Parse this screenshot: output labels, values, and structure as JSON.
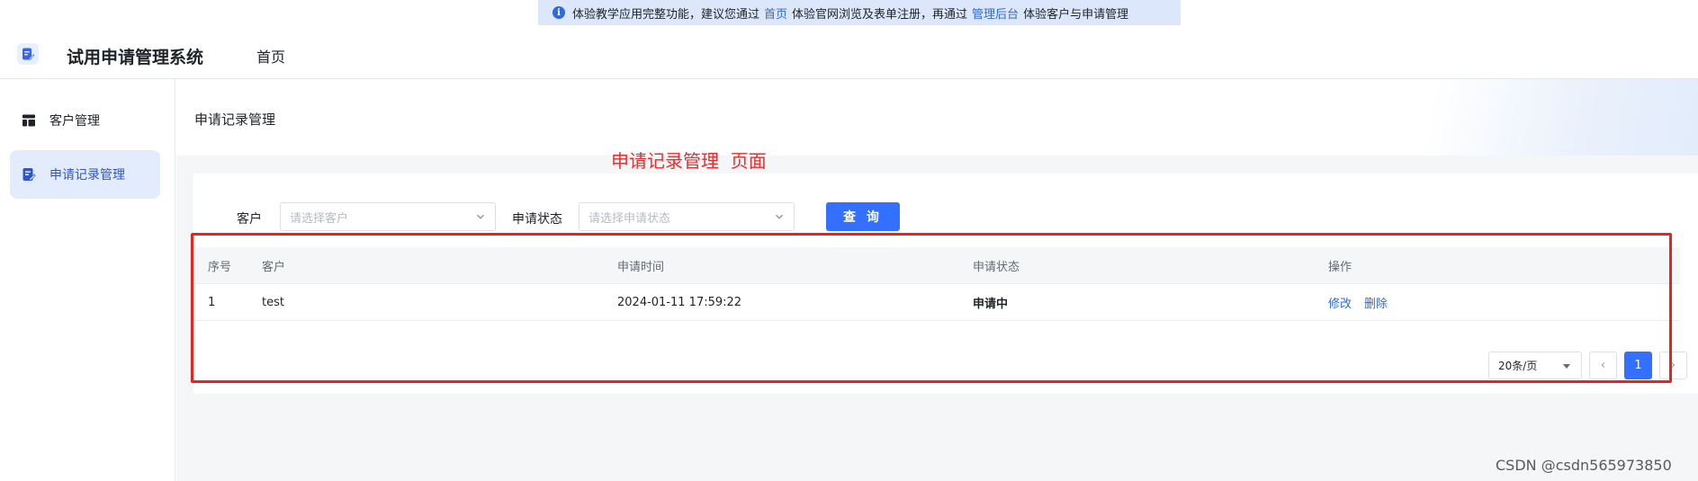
{
  "notice": {
    "text_1": "体验教学应用完整功能，建议您通过",
    "link_1": "首页",
    "text_2": "体验官网浏览及表单注册，再通过",
    "link_2": "管理后台",
    "text_3": "体验客户与申请管理"
  },
  "header": {
    "app_title": "试用申请管理系统",
    "nav_home": "首页"
  },
  "sidebar": {
    "items": [
      {
        "label": "客户管理",
        "icon": "layout-icon",
        "active": false
      },
      {
        "label": "申请记录管理",
        "icon": "edit-document-icon",
        "active": true
      }
    ]
  },
  "page": {
    "title": "申请记录管理",
    "annotation": "申请记录管理  页面"
  },
  "filters": {
    "customer_label": "客户",
    "customer_placeholder": "请选择客户",
    "status_label": "申请状态",
    "status_placeholder": "请选择申请状态",
    "query_button": "查 询"
  },
  "table": {
    "columns": [
      "序号",
      "客户",
      "申请时间",
      "申请状态",
      "操作"
    ],
    "rows": [
      {
        "index": "1",
        "customer": "test",
        "time": "2024-01-11 17:59:22",
        "status": "申请中",
        "edit": "修改",
        "delete": "删除"
      }
    ]
  },
  "pagination": {
    "page_size": "20条/页",
    "current_page": "1",
    "prev": "‹",
    "next": "›"
  },
  "watermark": "CSDN @csdn565973850",
  "colors": {
    "primary": "#3370ff",
    "annotation_red": "#ee2a2a",
    "active_nav_bg": "#e3ecfd"
  }
}
